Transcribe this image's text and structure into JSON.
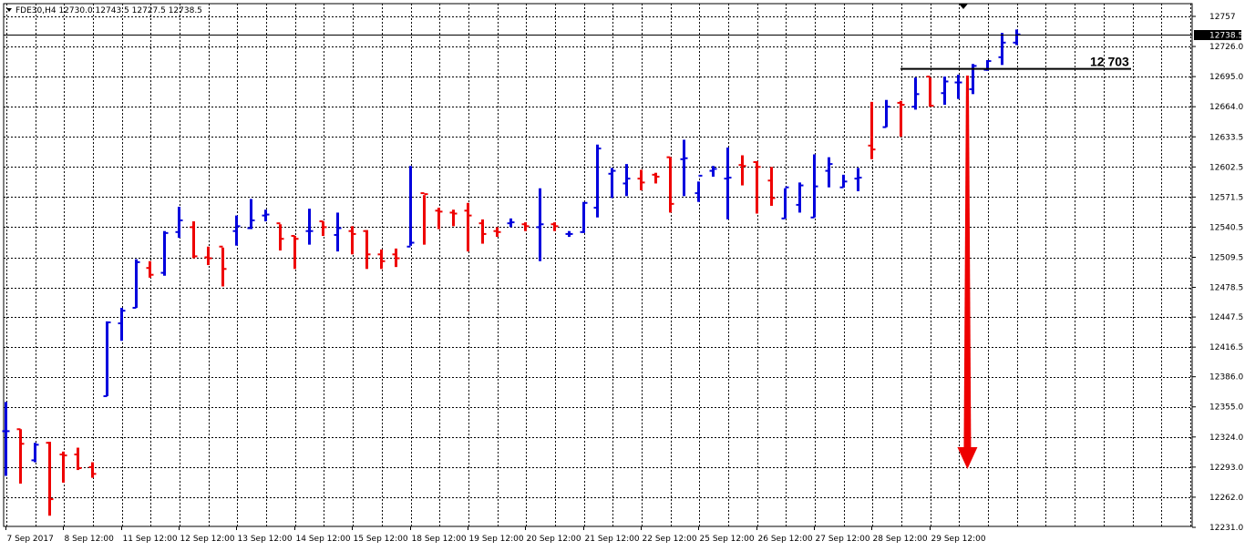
{
  "header": {
    "symbol_line": "FDE30,H4  12730.0  12743.5  12727.5  12738.5"
  },
  "current_price_label": "12738.5",
  "level_label": "12 703",
  "colors": {
    "up": "#0000dd",
    "down": "#ee0000",
    "grid": "#000000",
    "arrow": "#ee0000",
    "price_tag_bg": "#000000",
    "price_tag_text": "#ffffff"
  },
  "chart_data": {
    "type": "ohlc",
    "title": "FDE30,H4",
    "ylim": [
      12231,
      12772
    ],
    "y_ticks": [
      12757,
      12726,
      12695,
      12664,
      12633,
      12602,
      12571,
      12540,
      12509,
      12478,
      12447.5,
      12416.5,
      12386,
      12355,
      12324,
      12293,
      12262,
      12231
    ],
    "y_tick_labels": [
      "12757",
      "12726.0",
      "12695.0",
      "12664.0",
      "12633.5",
      "12602.5",
      "12571.5",
      "12540.5",
      "12509.5",
      "12478.5",
      "12447.5",
      "12416.5",
      "12386.0",
      "12355.0",
      "12324.0",
      "12293.0",
      "12262.0",
      "12231.0"
    ],
    "x_labels": [
      "7 Sep 2017",
      "8 Sep 12:00",
      "11 Sep 12:00",
      "12 Sep 12:00",
      "13 Sep 12:00",
      "14 Sep 12:00",
      "15 Sep 12:00",
      "18 Sep 12:00",
      "19 Sep 12:00",
      "20 Sep 12:00",
      "21 Sep 12:00",
      "22 Sep 12:00",
      "25 Sep 12:00",
      "26 Sep 12:00",
      "27 Sep 12:00",
      "28 Sep 12:00",
      "29 Sep 12:00"
    ],
    "x_label_bars": [
      0,
      4,
      8,
      12,
      16,
      20,
      24,
      28,
      32,
      36,
      40,
      44,
      48,
      52,
      56,
      60,
      64
    ],
    "current_price": 12738.5,
    "horizontal_level": 12703,
    "arrow": {
      "from_bar": 66,
      "from_price": 12696,
      "to_price": 12291,
      "direction": "down"
    },
    "bars": [
      {
        "o": 12330,
        "h": 12360,
        "l": 12284,
        "c": 12330
      },
      {
        "o": 12332,
        "h": 12332,
        "l": 12276,
        "c": 12317
      },
      {
        "o": 12300,
        "h": 12318,
        "l": 12298,
        "c": 12316
      },
      {
        "o": 12318,
        "h": 12319,
        "l": 12243,
        "c": 12260
      },
      {
        "o": 12306,
        "h": 12309,
        "l": 12277,
        "c": 12305
      },
      {
        "o": 12306,
        "h": 12313,
        "l": 12290,
        "c": 12292
      },
      {
        "o": 12293,
        "h": 12298,
        "l": 12282,
        "c": 12286
      },
      {
        "o": 12366,
        "h": 12443,
        "l": 12366,
        "c": 12442
      },
      {
        "o": 12441,
        "h": 12457,
        "l": 12423,
        "c": 12454
      },
      {
        "o": 12457,
        "h": 12507,
        "l": 12457,
        "c": 12504
      },
      {
        "o": 12498,
        "h": 12505,
        "l": 12488,
        "c": 12491
      },
      {
        "o": 12493,
        "h": 12536,
        "l": 12490,
        "c": 12534
      },
      {
        "o": 12535,
        "h": 12561,
        "l": 12529,
        "c": 12547
      },
      {
        "o": 12540,
        "h": 12546,
        "l": 12508,
        "c": 12510
      },
      {
        "o": 12509,
        "h": 12520,
        "l": 12501,
        "c": 12508
      },
      {
        "o": 12520,
        "h": 12519,
        "l": 12479,
        "c": 12497
      },
      {
        "o": 12536,
        "h": 12552,
        "l": 12521,
        "c": 12541
      },
      {
        "o": 12539,
        "h": 12569,
        "l": 12538,
        "c": 12547
      },
      {
        "o": 12552,
        "h": 12558,
        "l": 12546,
        "c": 12553
      },
      {
        "o": 12544,
        "h": 12543,
        "l": 12516,
        "c": 12528
      },
      {
        "o": 12531,
        "h": 12531,
        "l": 12497,
        "c": 12528
      },
      {
        "o": 12536,
        "h": 12559,
        "l": 12522,
        "c": 12536
      },
      {
        "o": 12546,
        "h": 12546,
        "l": 12531,
        "c": 12540
      },
      {
        "o": 12532,
        "h": 12555,
        "l": 12515,
        "c": 12539
      },
      {
        "o": 12536,
        "h": 12541,
        "l": 12512,
        "c": 12533
      },
      {
        "o": 12536,
        "h": 12537,
        "l": 12497,
        "c": 12512
      },
      {
        "o": 12512,
        "h": 12517,
        "l": 12497,
        "c": 12505
      },
      {
        "o": 12512,
        "h": 12518,
        "l": 12499,
        "c": 12508
      },
      {
        "o": 12520,
        "h": 12603,
        "l": 12521,
        "c": 12524
      },
      {
        "o": 12575,
        "h": 12573,
        "l": 12522,
        "c": 12574
      },
      {
        "o": 12557,
        "h": 12560,
        "l": 12538,
        "c": 12556
      },
      {
        "o": 12555,
        "h": 12558,
        "l": 12541,
        "c": 12554
      },
      {
        "o": 12557,
        "h": 12565,
        "l": 12515,
        "c": 12552
      },
      {
        "o": 12544,
        "h": 12548,
        "l": 12523,
        "c": 12533
      },
      {
        "o": 12536,
        "h": 12540,
        "l": 12530,
        "c": 12535
      },
      {
        "o": 12544,
        "h": 12549,
        "l": 12540,
        "c": 12545
      },
      {
        "o": 12543,
        "h": 12545,
        "l": 12536,
        "c": 12541
      },
      {
        "o": 12540,
        "h": 12580,
        "l": 12505,
        "c": 12543
      },
      {
        "o": 12543,
        "h": 12545,
        "l": 12536,
        "c": 12541
      },
      {
        "o": 12533,
        "h": 12536,
        "l": 12530,
        "c": 12533
      },
      {
        "o": 12535,
        "h": 12566,
        "l": 12534,
        "c": 12565
      },
      {
        "o": 12560,
        "h": 12625,
        "l": 12550,
        "c": 12621
      },
      {
        "o": 12595,
        "h": 12601,
        "l": 12570,
        "c": 12598
      },
      {
        "o": 12585,
        "h": 12605,
        "l": 12572,
        "c": 12590
      },
      {
        "o": 12590,
        "h": 12599,
        "l": 12578,
        "c": 12586
      },
      {
        "o": 12594,
        "h": 12596,
        "l": 12585,
        "c": 12592
      },
      {
        "o": 12612,
        "h": 12612,
        "l": 12555,
        "c": 12564
      },
      {
        "o": 12610,
        "h": 12630,
        "l": 12572,
        "c": 12611
      },
      {
        "o": 12575,
        "h": 12587,
        "l": 12566,
        "c": 12593
      },
      {
        "o": 12598,
        "h": 12603,
        "l": 12592,
        "c": 12600
      },
      {
        "o": 12590,
        "h": 12622,
        "l": 12548,
        "c": 12591
      },
      {
        "o": 12604,
        "h": 12614,
        "l": 12583,
        "c": 12603
      },
      {
        "o": 12607,
        "h": 12608,
        "l": 12554,
        "c": 12602
      },
      {
        "o": 12588,
        "h": 12602,
        "l": 12562,
        "c": 12570
      },
      {
        "o": 12549,
        "h": 12580,
        "l": 12549,
        "c": 12581
      },
      {
        "o": 12563,
        "h": 12555,
        "l": 12586,
        "c": 12583
      },
      {
        "o": 12550,
        "h": 12615,
        "l": 12550,
        "c": 12582
      },
      {
        "o": 12598,
        "h": 12612,
        "l": 12581,
        "c": 12605
      },
      {
        "o": 12581,
        "h": 12594,
        "l": 12581,
        "c": 12587
      },
      {
        "o": 12590,
        "h": 12601,
        "l": 12577,
        "c": 12591
      },
      {
        "o": 12624,
        "h": 12669,
        "l": 12610,
        "c": 12620
      },
      {
        "o": 12643,
        "h": 12671,
        "l": 12643,
        "c": 12664
      },
      {
        "o": 12668,
        "h": 12670,
        "l": 12633,
        "c": 12666
      },
      {
        "o": 12664,
        "h": 12694,
        "l": 12661,
        "c": 12677
      },
      {
        "o": 12695,
        "h": 12694,
        "l": 12664,
        "c": 12665
      },
      {
        "o": 12678,
        "h": 12695,
        "l": 12666,
        "c": 12690
      },
      {
        "o": 12689,
        "h": 12697,
        "l": 12672,
        "c": 12689
      },
      {
        "o": 12682,
        "h": 12708,
        "l": 12677,
        "c": 12706
      },
      {
        "o": 12702,
        "h": 12712,
        "l": 12701,
        "c": 12711
      },
      {
        "o": 12715,
        "h": 12740,
        "l": 12707,
        "c": 12730
      },
      {
        "o": 12730,
        "h": 12743.5,
        "l": 12727.5,
        "c": 12738.5
      }
    ]
  }
}
